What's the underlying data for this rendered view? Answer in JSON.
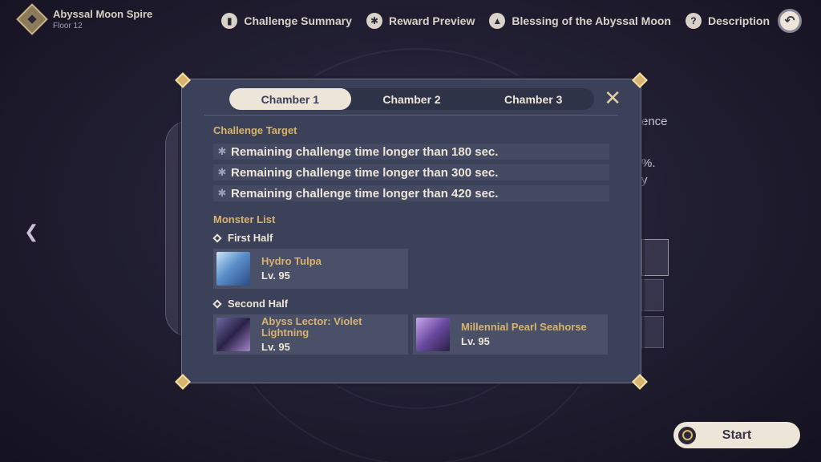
{
  "header": {
    "title": "Abyssal Moon Spire",
    "subtitle": "Floor 12",
    "nav": [
      {
        "label": "Challenge Summary",
        "icon": "book-icon"
      },
      {
        "label": "Reward Preview",
        "icon": "star-badge-icon"
      },
      {
        "label": "Blessing of the Abyssal Moon",
        "icon": "up-arrow-icon"
      },
      {
        "label": "Description",
        "icon": "question-icon"
      }
    ]
  },
  "background": {
    "partial_text_1": "ence",
    "partial_text_2": "%.",
    "partial_text_3": "y"
  },
  "modal": {
    "tabs": [
      "Chamber 1",
      "Chamber 2",
      "Chamber 3"
    ],
    "active_tab": 0,
    "challenge_target_label": "Challenge Target",
    "targets": [
      "Remaining challenge time longer than 180 sec.",
      "Remaining challenge time longer than 300 sec.",
      "Remaining challenge time longer than 420 sec."
    ],
    "monster_list_label": "Monster List",
    "first_half_label": "First Half",
    "first_half": [
      {
        "name": "Hydro Tulpa",
        "level": "Lv. 95"
      }
    ],
    "second_half_label": "Second Half",
    "second_half": [
      {
        "name": "Abyss Lector: Violet Lightning",
        "level": "Lv. 95"
      },
      {
        "name": "Millennial Pearl Seahorse",
        "level": "Lv. 95"
      }
    ]
  },
  "start_button": {
    "label": "Start"
  }
}
